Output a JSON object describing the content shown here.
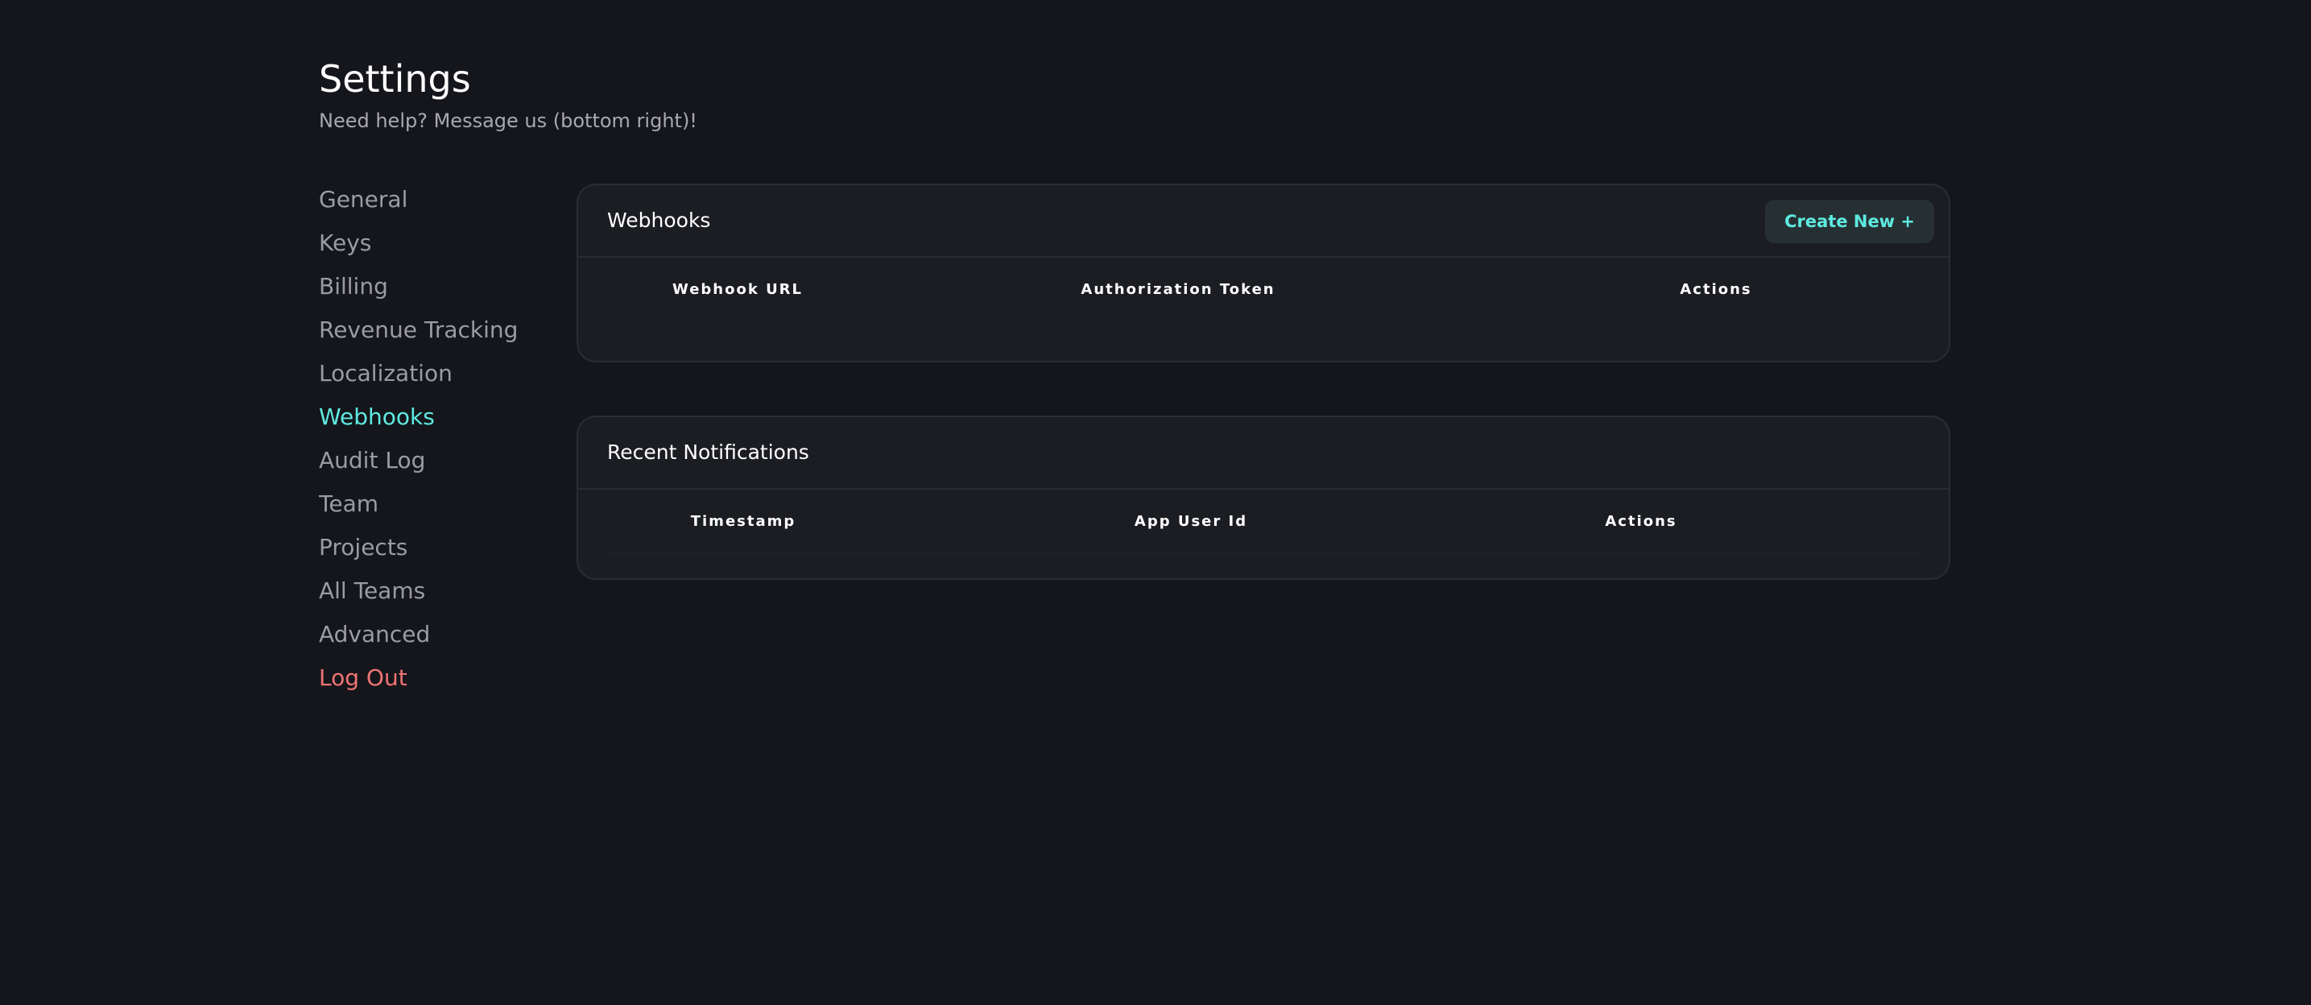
{
  "page": {
    "title": "Settings",
    "subtitle": "Need help? Message us (bottom right)!"
  },
  "sidebar": {
    "items": [
      {
        "label": "General"
      },
      {
        "label": "Keys"
      },
      {
        "label": "Billing"
      },
      {
        "label": "Revenue Tracking"
      },
      {
        "label": "Localization"
      },
      {
        "label": "Webhooks"
      },
      {
        "label": "Audit Log"
      },
      {
        "label": "Team"
      },
      {
        "label": "Projects"
      },
      {
        "label": "All Teams"
      },
      {
        "label": "Advanced"
      },
      {
        "label": "Log Out"
      }
    ],
    "active": "Webhooks"
  },
  "webhooks": {
    "title": "Webhooks",
    "create_button": "Create New +",
    "columns": [
      "Webhook URL",
      "Authorization Token",
      "Actions"
    ],
    "rows": []
  },
  "notifications": {
    "title": "Recent Notifications",
    "columns": [
      "Timestamp",
      "App User Id",
      "Actions"
    ],
    "rows": []
  },
  "colors": {
    "background": "#15161b",
    "card": "#1b1d22",
    "accent": "#5eeae0",
    "danger": "#f07474",
    "muted_text": "#9b9ca2"
  }
}
